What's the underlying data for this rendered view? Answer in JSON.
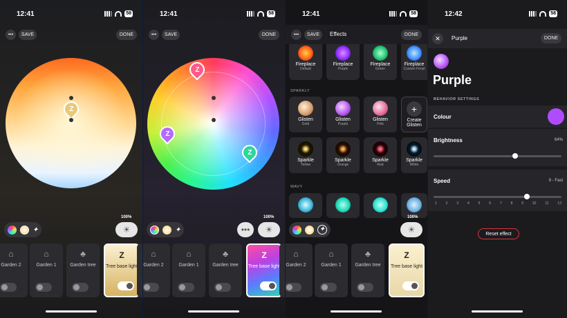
{
  "status": {
    "time1": "12:41",
    "time2": "12:41",
    "time3": "12:41",
    "time4": "12:42",
    "battery": "58"
  },
  "buttons": {
    "save": "SAVE",
    "done": "DONE"
  },
  "brightness_pct": "100%",
  "cards": [
    {
      "label": "Garden 2"
    },
    {
      "label": "Garden 1"
    },
    {
      "label": "Garden tree"
    },
    {
      "label": "Tree base light"
    }
  ],
  "effects": {
    "title": "Effects",
    "section_sparkly": "SPARKLY",
    "section_wavy": "WAVY",
    "fireplace": [
      {
        "name": "Fireplace",
        "sub": "Default",
        "color": "#ff7a1f"
      },
      {
        "name": "Fireplace",
        "sub": "Purple",
        "color": "#9b2cff"
      },
      {
        "name": "Fireplace",
        "sub": "Green",
        "color": "#21e07a"
      },
      {
        "name": "Fireplace",
        "sub": "Custom Firepl",
        "color": "#3aa8ff"
      }
    ],
    "glisten": [
      {
        "name": "Glisten",
        "sub": "Gold",
        "color": "#f2c299"
      },
      {
        "name": "Glisten",
        "sub": "Purple",
        "color": "#c56cf5"
      },
      {
        "name": "Glisten",
        "sub": "Pink",
        "color": "#ee7fa8"
      },
      {
        "name": "Create Glisten",
        "sub": "",
        "color": ""
      }
    ],
    "sparkle": [
      {
        "name": "Sparkle",
        "sub": "Yellow",
        "color": "#ffcc3a"
      },
      {
        "name": "Sparkle",
        "sub": "Orange",
        "color": "#ff8a2a"
      },
      {
        "name": "Sparkle",
        "sub": "Red",
        "color": "#ff3a4a"
      },
      {
        "name": "Sparkle",
        "sub": "White",
        "color": "#aad4ff"
      }
    ]
  },
  "detail": {
    "title": "Purple",
    "heading": "Purple",
    "section": "BEHAVIOR SETTINGS",
    "colour_label": "Colour",
    "colour_value": "#b04cff",
    "brightness_label": "Brightness",
    "brightness_value": "64%",
    "brightness_level": 0.64,
    "speed_label": "Speed",
    "speed_value": "9 - Fast",
    "speed_ticks": [
      "1",
      "2",
      "3",
      "4",
      "5",
      "6",
      "7",
      "8",
      "9",
      "10",
      "11",
      "12"
    ],
    "reset": "Reset effect"
  }
}
